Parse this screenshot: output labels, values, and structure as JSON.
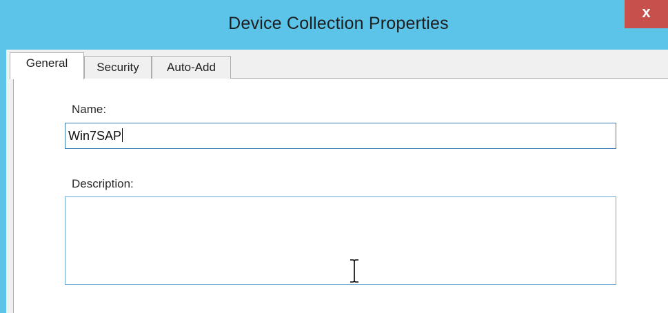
{
  "window": {
    "title": "Device Collection Properties",
    "close_label": "x"
  },
  "tabs": [
    {
      "label": "General",
      "active": true
    },
    {
      "label": "Security",
      "active": false
    },
    {
      "label": "Auto-Add",
      "active": false
    }
  ],
  "form": {
    "name_label": "Name:",
    "name_value": "Win7SAP",
    "description_label": "Description:",
    "description_value": ""
  },
  "colors": {
    "titlebar": "#5bc4e8",
    "close_button": "#c7504a",
    "input_border": "#3a7ab0"
  },
  "icons": {
    "cursor": "i-beam-cursor-icon"
  }
}
